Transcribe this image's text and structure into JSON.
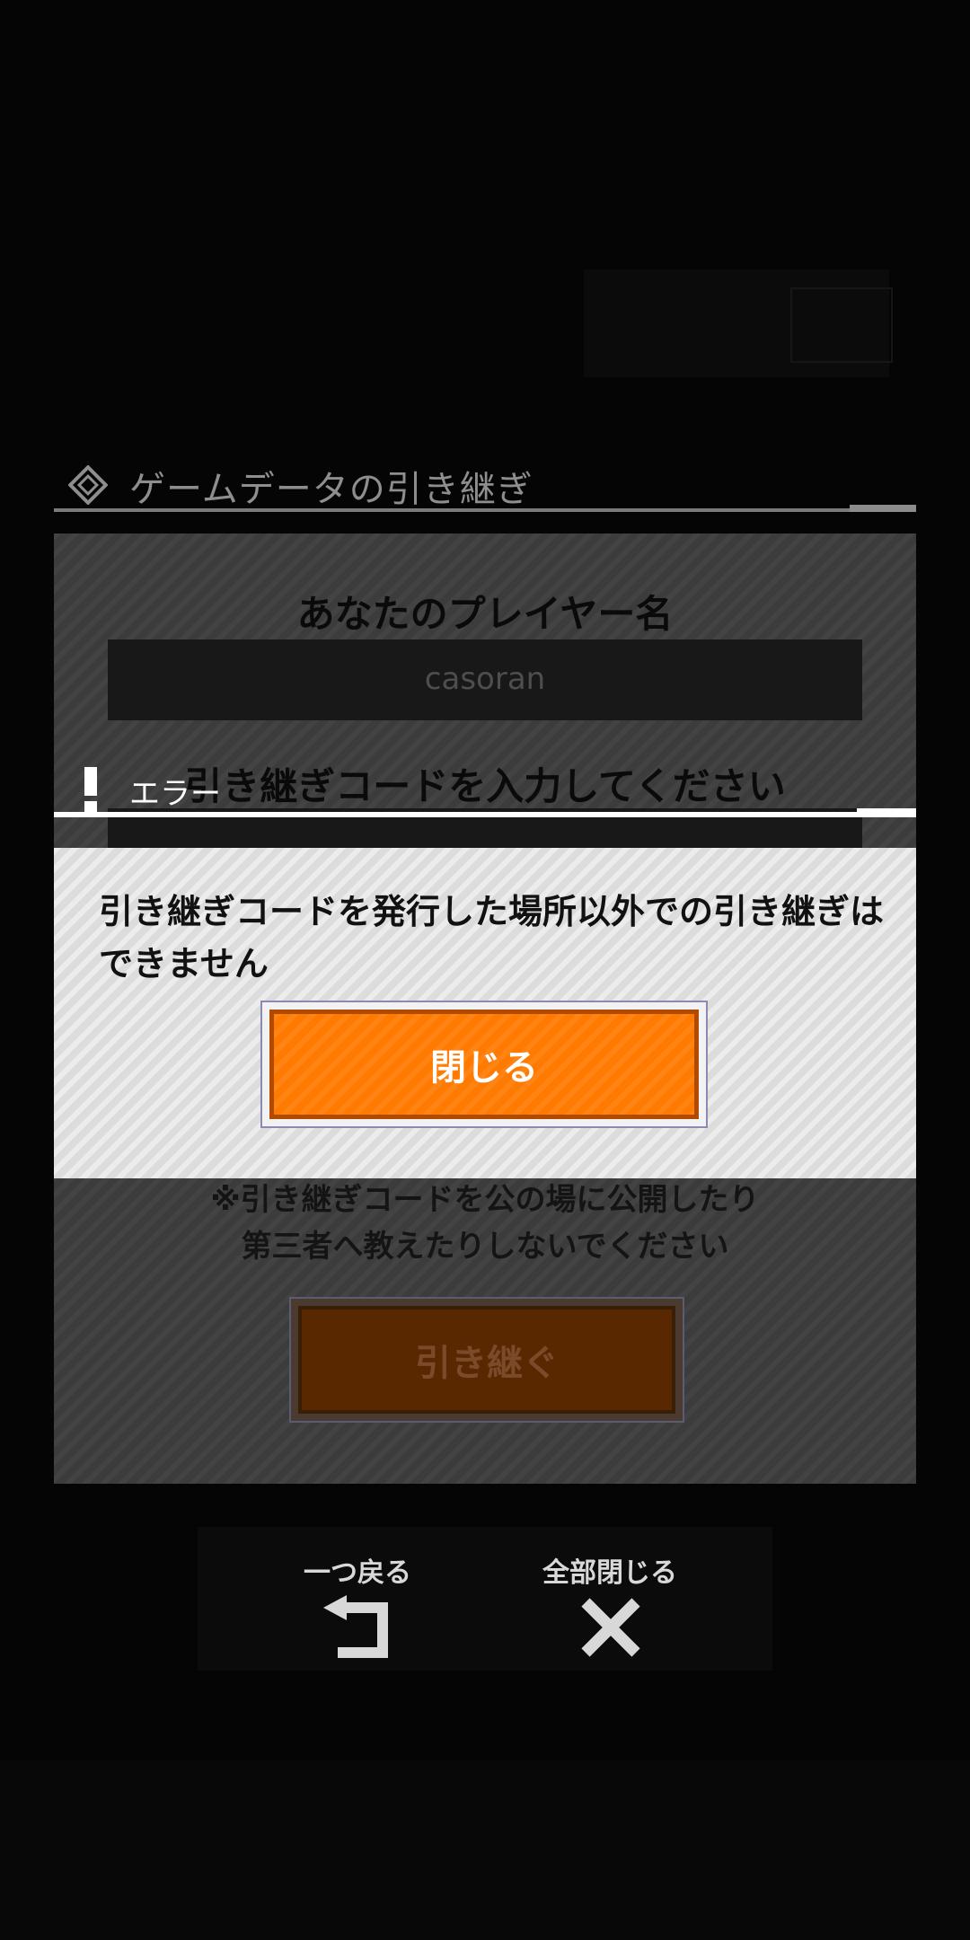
{
  "transfer_dialog": {
    "title": "ゲームデータの引き継ぎ",
    "player_name_heading": "あなたのプレイヤー名",
    "player_name_value": "casoran",
    "code_heading": "引き継ぎコードを入力してください",
    "notes": [
      "※引き継ぎコードを公の場に公開したり",
      "第三者へ教えたりしないでください"
    ],
    "transfer_button_label": "引き継ぐ"
  },
  "error_modal": {
    "title": "エラー",
    "message": "引き継ぎコードを発行した場所以外での引き継ぎはできません",
    "close_button_label": "閉じる"
  },
  "bottom_nav": {
    "back_label": "一つ戻る",
    "close_all_label": "全部閉じる",
    "back_icon": "return-arrow-icon",
    "close_all_icon": "close-x-icon"
  },
  "colors": {
    "accent_orange": "#ff7a00",
    "overlay_dark": "#050505"
  }
}
